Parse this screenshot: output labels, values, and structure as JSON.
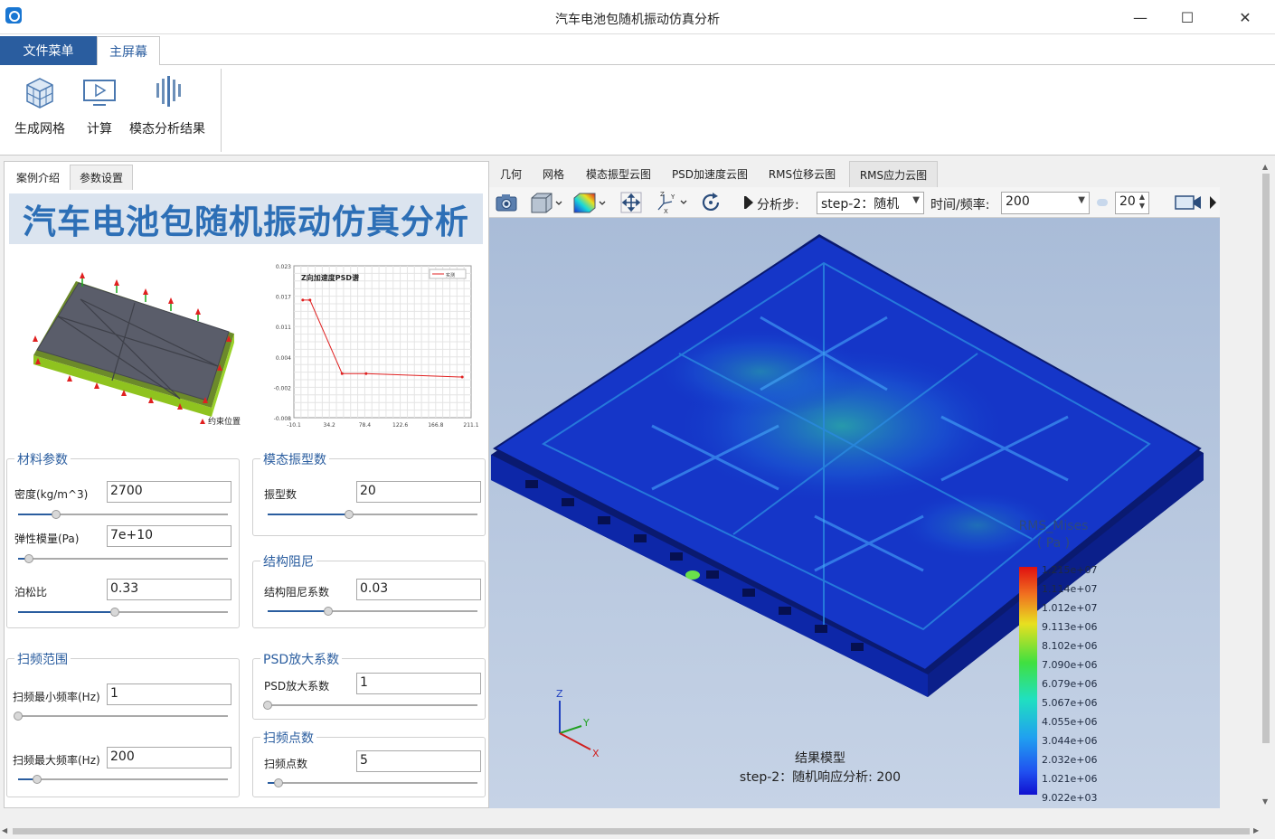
{
  "window": {
    "title": "汽车电池包随机振动仿真分析",
    "minimize": "—",
    "maximize": "☐",
    "close": "✕"
  },
  "menu": {
    "file": "文件菜单",
    "home": "主屏幕"
  },
  "ribbon": {
    "mesh": "生成网格",
    "compute": "计算",
    "modal": "模态分析结果"
  },
  "left_tabs": {
    "intro": "案例介绍",
    "params": "参数设置"
  },
  "banner": "汽车电池包随机振动仿真分析",
  "model_image": {
    "legend": "约束位置"
  },
  "psd_chart": {
    "title": "Z向加速度PSD谱",
    "legend": "实测",
    "y_ticks": [
      "0.023",
      "0.017",
      "0.011",
      "0.004",
      "-0.002",
      "-0.008"
    ],
    "x_ticks": [
      "-10.1",
      "34.2",
      "78.4",
      "122.6",
      "166.8",
      "211.1"
    ],
    "points": [
      {
        "x": 1,
        "y": 0.016
      },
      {
        "x": 10,
        "y": 0.016
      },
      {
        "x": 50,
        "y": 0.001
      },
      {
        "x": 80,
        "y": 0.001
      },
      {
        "x": 200,
        "y": 0.0003
      }
    ]
  },
  "material": {
    "title": "材料参数",
    "density_label": "密度(kg/m^3)",
    "density": "2700",
    "density_level": 0.18,
    "modulus_label": "弹性模量(Pa)",
    "modulus": "7e+10",
    "modulus_level": 0.05,
    "poisson_label": "泊松比",
    "poisson": "0.33",
    "poisson_level": 0.46
  },
  "modal": {
    "title": "模态振型数",
    "count_label": "振型数",
    "count": "20",
    "count_level": 0.39
  },
  "damping": {
    "title": "结构阻尼",
    "coef_label": "结构阻尼系数",
    "coef": "0.03",
    "coef_level": 0.29
  },
  "sweep": {
    "title": "扫频范围",
    "min_label": "扫频最小频率(Hz)",
    "min": "1",
    "min_level": 0.0,
    "max_label": "扫频最大频率(Hz)",
    "max": "200",
    "max_level": 0.09
  },
  "psd": {
    "title": "PSD放大系数",
    "factor_label": "PSD放大系数",
    "factor": "1",
    "factor_level": 0.0
  },
  "points": {
    "title": "扫频点数",
    "count_label": "扫频点数",
    "count": "5",
    "count_level": 0.05
  },
  "view_tabs": [
    "几何",
    "网格",
    "模态振型云图",
    "PSD加速度云图",
    "RMS位移云图",
    "RMS应力云图"
  ],
  "toolbar": {
    "step_label": "分析步:",
    "step_value": "step-2：随机",
    "time_label": "时间/频率:",
    "time_value": "200",
    "spin_value": "20"
  },
  "legend": {
    "title": "RMS_Mises",
    "unit": "( Pa )",
    "values": [
      "1.215e+07",
      "1.114e+07",
      "1.012e+07",
      "9.113e+06",
      "8.102e+06",
      "7.090e+06",
      "6.079e+06",
      "5.067e+06",
      "4.055e+06",
      "3.044e+06",
      "2.032e+06",
      "1.021e+06",
      "9.022e+03"
    ]
  },
  "caption": {
    "line1": "结果模型",
    "line2": "step-2：随机响应分析: 200"
  },
  "axes": {
    "z": "Z",
    "y": "Y",
    "x": "X"
  }
}
